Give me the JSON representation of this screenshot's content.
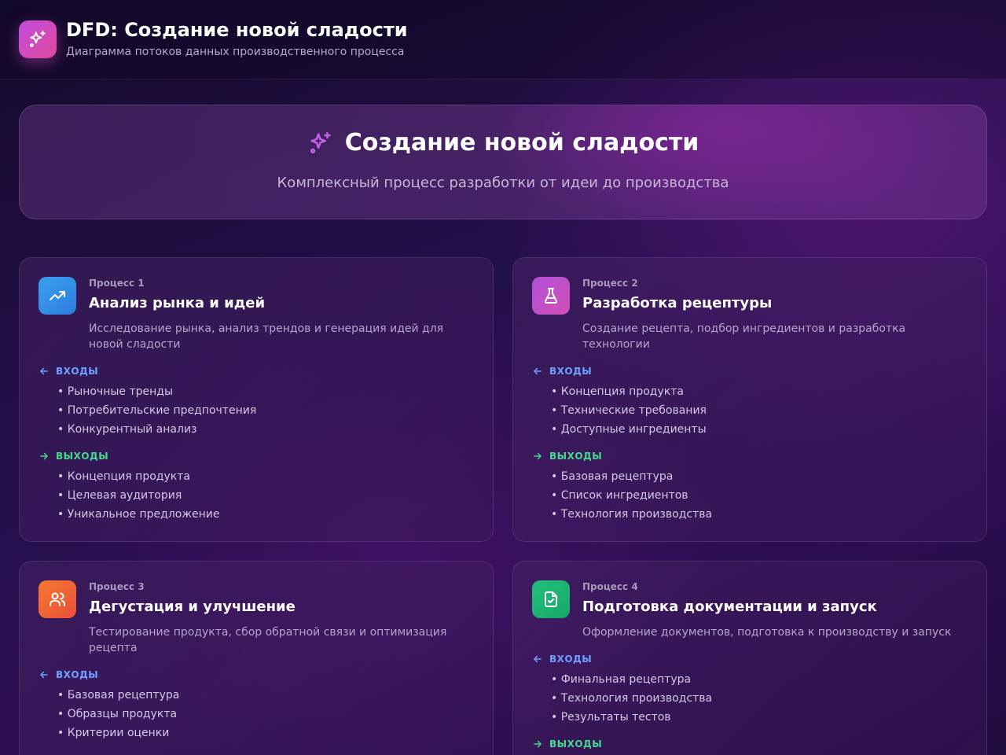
{
  "header": {
    "title": "DFD: Создание новой сладости",
    "subtitle": "Диаграмма потоков данных производственного процесса",
    "logo_icon": "sparkles-icon"
  },
  "hero": {
    "title": "Создание новой сладости",
    "subtitle": "Комплексный процесс разработки от идеи до производства",
    "icon": "sparkles-icon"
  },
  "labels": {
    "inputs": "ВХОДЫ",
    "outputs": "ВЫХОДЫ"
  },
  "processes": [
    {
      "kicker": "Процесс 1",
      "title": "Анализ рынка и идей",
      "description": "Исследование рынка, анализ трендов и генерация идей для новой сладости",
      "icon": "trending-up-icon",
      "color_from": "#3aa0f0",
      "color_to": "#2f7de0",
      "inputs": [
        "Рыночные тренды",
        "Потребительские предпочтения",
        "Конкурентный анализ"
      ],
      "outputs": [
        "Концепция продукта",
        "Целевая аудитория",
        "Уникальное предложение"
      ]
    },
    {
      "kicker": "Процесс 2",
      "title": "Разработка рецептуры",
      "description": "Создание рецепта, подбор ингредиентов и разработка технологии",
      "icon": "flask-icon",
      "color_from": "#b24fd9",
      "color_to": "#d24fb5",
      "inputs": [
        "Концепция продукта",
        "Технические требования",
        "Доступные ингредиенты"
      ],
      "outputs": [
        "Базовая рецептура",
        "Список ингредиентов",
        "Технология производства"
      ]
    },
    {
      "kicker": "Процесс 3",
      "title": "Дегустация и улучшение",
      "description": "Тестирование продукта, сбор обратной связи и оптимизация рецепта",
      "icon": "users-icon",
      "color_from": "#f5792e",
      "color_to": "#ea4f3a",
      "inputs": [
        "Базовая рецептура",
        "Образцы продукта",
        "Критерии оценки"
      ],
      "outputs": []
    },
    {
      "kicker": "Процесс 4",
      "title": "Подготовка документации и запуск",
      "description": "Оформление документов, подготовка к производству и запуск",
      "icon": "file-check-icon",
      "color_from": "#22c07a",
      "color_to": "#17a868",
      "inputs": [
        "Финальная рецептура",
        "Технология производства",
        "Результаты тестов"
      ],
      "outputs": []
    }
  ]
}
